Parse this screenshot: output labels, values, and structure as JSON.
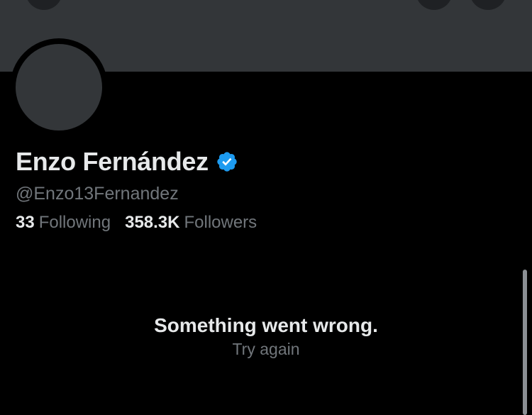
{
  "profile": {
    "display_name": "Enzo Fernández",
    "handle": "@Enzo13Fernandez",
    "verified": true,
    "verified_color": "#1d9bf0"
  },
  "stats": {
    "following_count": "33",
    "following_label": "Following",
    "followers_count": "358.3K",
    "followers_label": "Followers"
  },
  "error": {
    "message": "Something went wrong.",
    "retry_label": "Try again"
  },
  "icons": {
    "top_left": "back-arrow-icon",
    "top_right_1": "search-icon",
    "top_right_2": "more-icon"
  },
  "colors": {
    "background": "#000000",
    "banner": "#333639",
    "primary_text": "#e7e9ea",
    "secondary_text": "#71767b"
  }
}
